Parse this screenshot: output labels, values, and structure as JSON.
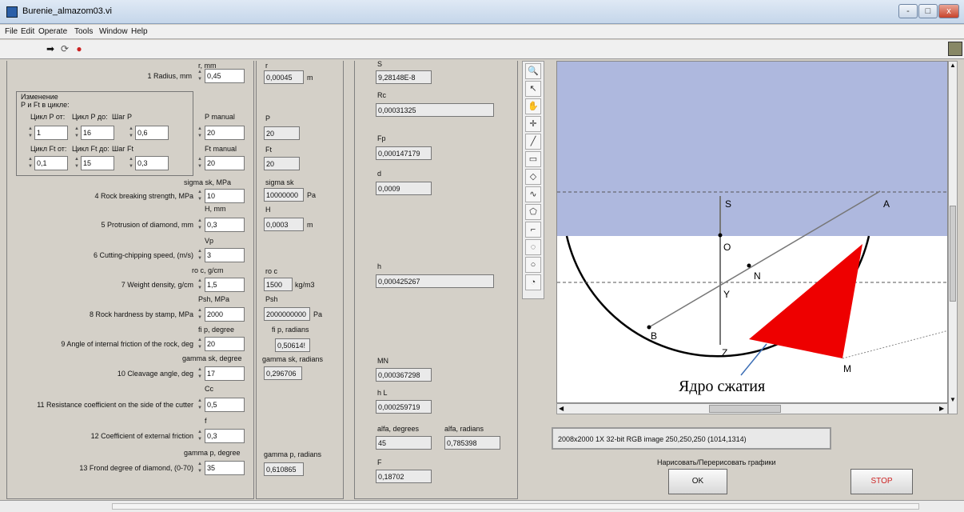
{
  "window": {
    "title": "Burenie_almazom03.vi",
    "minimize": "-",
    "maximize": "□",
    "close": "x"
  },
  "menu": [
    "File",
    "Edit",
    "Operate",
    "Tools",
    "Window",
    "Help"
  ],
  "toolbar_icons": [
    "run-arrow-icon",
    "run-continuous-icon",
    "abort-icon"
  ],
  "inputs": {
    "radius": {
      "label": "1 Radius, mm",
      "caption": "r, mm",
      "value": "0,45"
    },
    "cycle": {
      "title_line1": "Изменение",
      "title_line2": "P и Ft в цикле:",
      "p_from_label": "Цикл P от:",
      "p_from": "1",
      "p_to_label": "Цикл P до:",
      "p_to": "16",
      "p_step_label": "Шаг P",
      "p_step": "0,6",
      "ft_from_label": "Цикл Ft от:",
      "ft_from": "0,1",
      "ft_to_label": "Цикл Ft до:",
      "ft_to": "15",
      "ft_step_label": "Шаг Ft",
      "ft_step": "0,3"
    },
    "p_manual": {
      "caption": "P manual",
      "value": "20"
    },
    "ft_manual": {
      "caption": "Ft manual",
      "value": "20"
    },
    "rock_strength": {
      "label": "4 Rock breaking strength, MPa",
      "caption": "sigma sk, MPa",
      "value": "10"
    },
    "protrusion": {
      "label": "5  Protrusion of diamond, mm",
      "caption": "H, mm",
      "value": "0,3"
    },
    "speed": {
      "label": "6 Cutting-chipping speed, (m/s)",
      "caption": "Vp",
      "value": "3"
    },
    "density": {
      "label": "7 Weight density, g/cm",
      "caption": "ro c, g/cm",
      "value": "1,5"
    },
    "hardness": {
      "label": "8 Rock hardness by stamp, MPa",
      "caption": "Psh, MPa",
      "value": "2000"
    },
    "friction_angle": {
      "label": "9 Angle of internal friction of the rock, deg",
      "caption": "fi p, degree",
      "value": "20"
    },
    "cleavage": {
      "label": "10 Cleavage angle, deg",
      "caption": "gamma sk, degree",
      "value": "17"
    },
    "resistance": {
      "label": "11 Resistance coefficient on the side of the cutter",
      "caption": "Cc",
      "value": "0,5"
    },
    "ext_friction": {
      "label": "12 Coefficient of external friction",
      "caption": "f",
      "value": "0,3"
    },
    "frond": {
      "label": "13 Frond degree of diamond, (0-70)",
      "caption": "gamma p, degree",
      "value": "35"
    }
  },
  "converted": {
    "r": {
      "caption": "r",
      "value": "0,00045",
      "unit": "m"
    },
    "p": {
      "caption": "P",
      "value": "20"
    },
    "ft": {
      "caption": "Ft",
      "value": "20"
    },
    "sigma": {
      "caption": "sigma sk",
      "value": "10000000",
      "unit": "Pa"
    },
    "h": {
      "caption": "H",
      "value": "0,0003",
      "unit": "m"
    },
    "ro": {
      "caption": "ro c",
      "value": "1500",
      "unit": "kg/m3"
    },
    "psh": {
      "caption": "Psh",
      "value": "2000000000",
      "unit": "Pa"
    },
    "fi": {
      "caption": "fi p, radians",
      "value": "0,50614!"
    },
    "gamma_sk": {
      "caption": "gamma sk, radians",
      "value": "0,296706"
    },
    "gamma_p": {
      "caption": "gamma p, radians",
      "value": "0,610865"
    }
  },
  "results": {
    "s": {
      "caption": "S",
      "value": "9,28148E-8"
    },
    "rc": {
      "caption": "Rc",
      "value": "0,00031325"
    },
    "fp": {
      "caption": "Fp",
      "value": "0,000147179"
    },
    "d": {
      "caption": "d",
      "value": "0,0009"
    },
    "h": {
      "caption": "h",
      "value": "0,000425267"
    },
    "mn": {
      "caption": "MN",
      "value": "0,000367298"
    },
    "hl": {
      "caption": "h L",
      "value": "0,000259719"
    },
    "alfa_deg": {
      "caption": "alfa, degrees",
      "value": "45"
    },
    "alfa_rad": {
      "caption": "alfa, radians",
      "value": "0,785398"
    },
    "f": {
      "caption": "F",
      "value": "0,18702"
    }
  },
  "drawing": {
    "points": [
      "S",
      "O",
      "A",
      "N",
      "Y",
      "B",
      "Z",
      "M"
    ],
    "annotation": "Ядро сжатия",
    "colors": {
      "rock": "#aeb8de",
      "core": "#ee0000",
      "background": "#ffffff"
    }
  },
  "image_info": "2008x2000 1X 32-bit RGB image 250,250,250   (1014,1314)",
  "draw_button_caption": "Нарисовать/Перерисовать графики",
  "ok_label": "OK",
  "stop_label": "STOP"
}
